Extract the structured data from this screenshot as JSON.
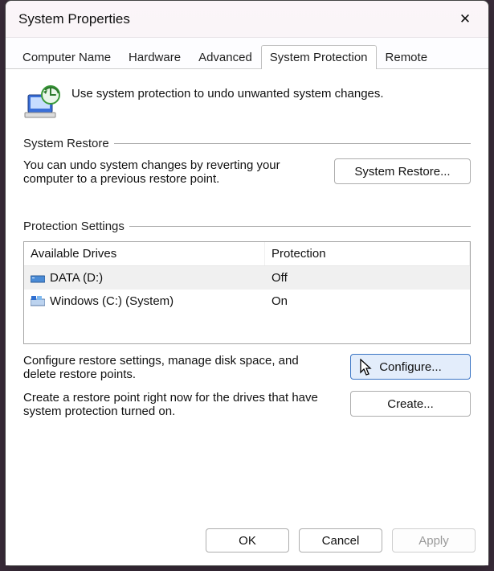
{
  "window": {
    "title": "System Properties"
  },
  "tabs": [
    {
      "label": "Computer Name"
    },
    {
      "label": "Hardware"
    },
    {
      "label": "Advanced"
    },
    {
      "label": "System Protection"
    },
    {
      "label": "Remote"
    }
  ],
  "active_tab_index": 3,
  "intro": "Use system protection to undo unwanted system changes.",
  "groups": {
    "restore": {
      "title": "System Restore",
      "text": "You can undo system changes by reverting your computer to a previous restore point.",
      "button": "System Restore..."
    },
    "protection": {
      "title": "Protection Settings",
      "columns": {
        "c1": "Available Drives",
        "c2": "Protection"
      },
      "rows": [
        {
          "name": "DATA (D:)",
          "protection": "Off",
          "selected": true,
          "drive_type": "data"
        },
        {
          "name": "Windows (C:) (System)",
          "protection": "On",
          "selected": false,
          "drive_type": "system"
        }
      ],
      "configure_text": "Configure restore settings, manage disk space, and delete restore points.",
      "configure_button": "Configure...",
      "create_text": "Create a restore point right now for the drives that have system protection turned on.",
      "create_button": "Create..."
    }
  },
  "footer": {
    "ok": "OK",
    "cancel": "Cancel",
    "apply": "Apply"
  }
}
